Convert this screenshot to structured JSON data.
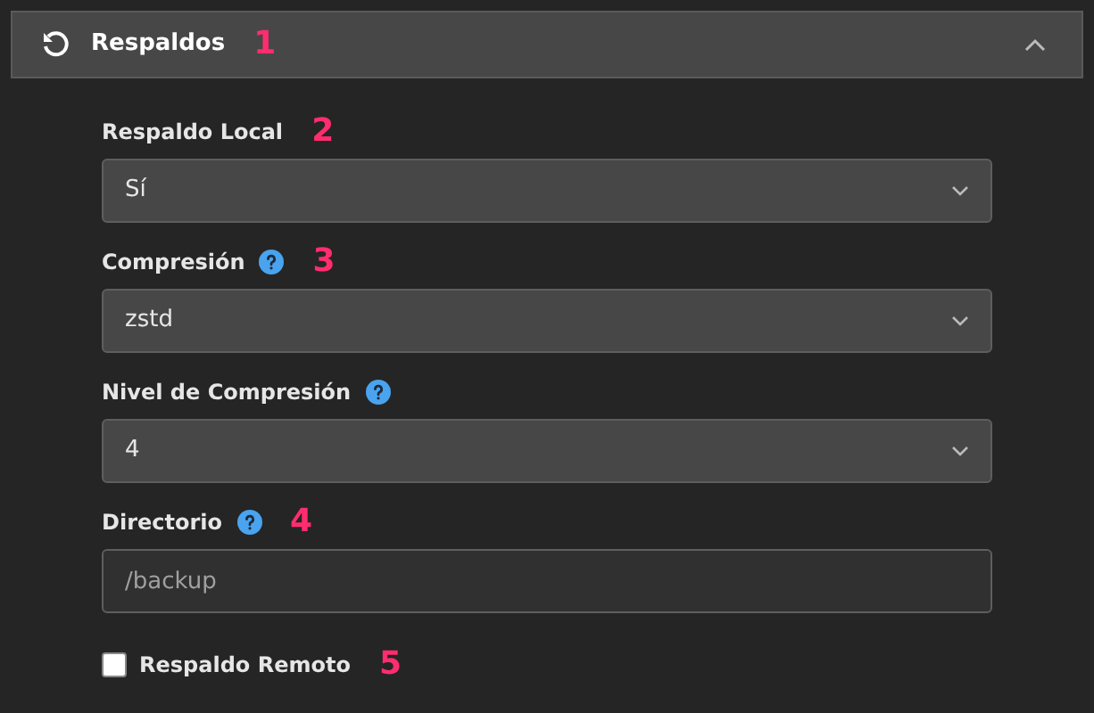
{
  "header": {
    "title": "Respaldos",
    "marker": "1",
    "expanded": true
  },
  "fields": [
    {
      "kind": "select",
      "label": "Respaldo Local",
      "marker": "2",
      "value": "Sí"
    },
    {
      "kind": "select",
      "label": "Compresión",
      "help": true,
      "marker": "3",
      "value": "zstd"
    },
    {
      "kind": "select",
      "label": "Nivel de Compresión",
      "help": true,
      "value": "4"
    },
    {
      "kind": "text",
      "label": "Directorio",
      "help": true,
      "marker": "4",
      "placeholder": "/backup"
    },
    {
      "kind": "checkbox",
      "label": "Respaldo Remoto",
      "checked": false,
      "marker": "5"
    }
  ]
}
